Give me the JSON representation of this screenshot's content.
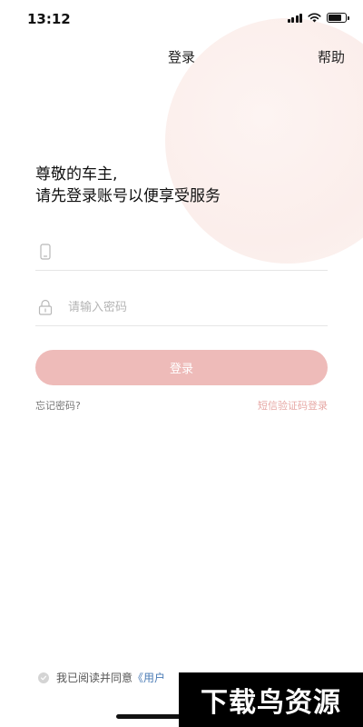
{
  "status_bar": {
    "time": "13:12",
    "battery_level": 0.85,
    "icons": [
      "signal-icon",
      "wifi-icon",
      "battery-icon"
    ]
  },
  "nav": {
    "title": "登录",
    "help_label": "帮助"
  },
  "greeting": {
    "line1": "尊敬的车主,",
    "line2": "请先登录账号以便享受服务"
  },
  "form": {
    "phone": {
      "icon": "phone-icon",
      "value": "",
      "placeholder": ""
    },
    "password": {
      "icon": "lock-icon",
      "value": "",
      "placeholder": "请输入密码"
    },
    "login_label": "登录",
    "forgot_label": "忘记密码?",
    "sms_login_label": "短信验证码登录"
  },
  "agreement": {
    "text": "我已阅读并同意",
    "link_text": "《用户"
  },
  "watermark": {
    "text": "下载鸟资源"
  },
  "colors": {
    "accent": "#eebbb9",
    "link_pink": "#e7a9a6",
    "link_blue": "#4a7bb5"
  }
}
